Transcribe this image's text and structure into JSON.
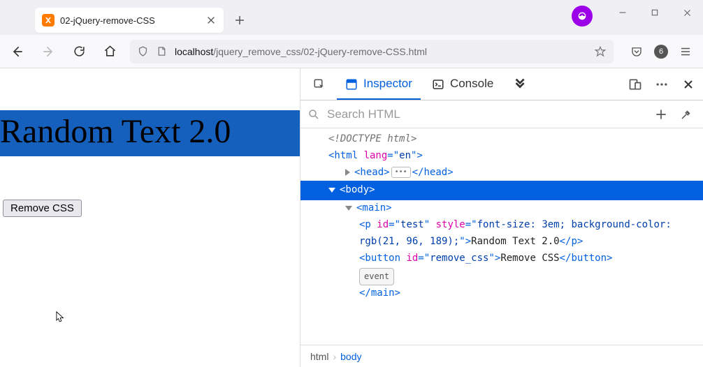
{
  "window": {
    "tab_title": "02-jQuery-remove-CSS"
  },
  "toolbar": {
    "url_host": "localhost",
    "url_path": "/jquery_remove_css/02-jQuery-remove-CSS.html",
    "tracker_count": "6"
  },
  "page": {
    "paragraph_text": "Random Text 2.0",
    "button_label": "Remove CSS"
  },
  "devtools": {
    "tab_inspector": "Inspector",
    "tab_console": "Console",
    "search_placeholder": "Search HTML",
    "badge_event": "event",
    "crumb_html": "html",
    "crumb_body": "body",
    "dom": {
      "doctype": "<!DOCTYPE html>",
      "html_open": "<html lang=\"en\">",
      "head_open": "<head>",
      "head_close": "</head>",
      "body_open": "<body>",
      "main_open": "<main>",
      "p_source": "<p id=\"test\" style=\"font-size: 3em; background-color: rgb(21, 96, 189);\">Random Text 2.0</p>",
      "button_source": "<button id=\"remove_css\">Remove CSS</button>",
      "main_close": "</main>"
    }
  }
}
